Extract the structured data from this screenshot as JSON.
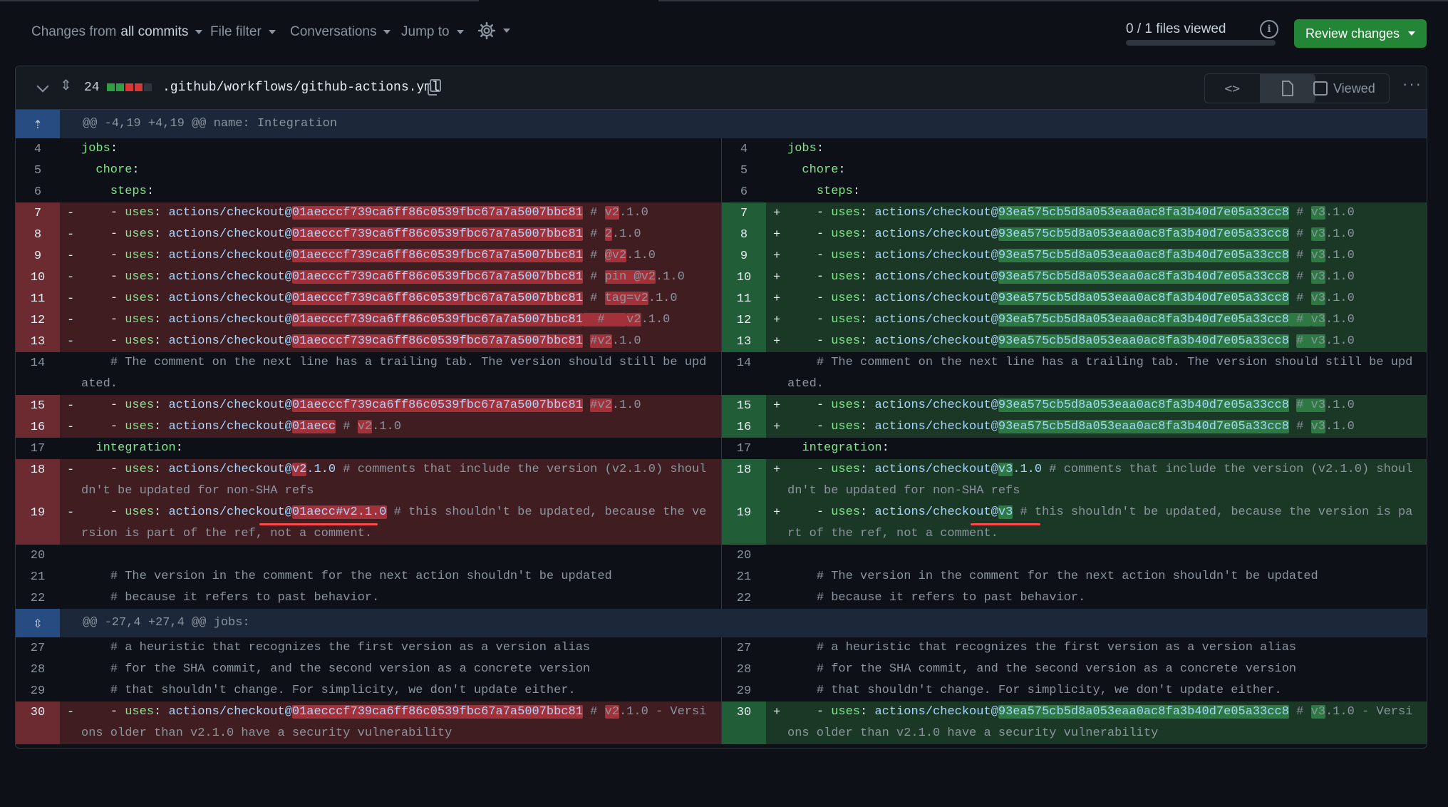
{
  "toolbar": {
    "changes_prefix": "Changes from",
    "changes_value": "all commits",
    "file_filter": "File filter",
    "conversations": "Conversations",
    "jump_to": "Jump to",
    "files_viewed": "0 / 1 files viewed",
    "progress": 0,
    "review_button": "Review changes"
  },
  "file": {
    "change_count": "24",
    "stat_blocks": [
      "#2ea043",
      "#2ea043",
      "#da3633",
      "#da3633",
      "#30363d"
    ],
    "path": ".github/workflows/github-actions.yml",
    "viewed_label": "Viewed"
  },
  "colors": {
    "accent_green": "#238636",
    "deletion": "#da3633",
    "addition": "#2ea043"
  },
  "hunks": [
    {
      "header": "@@ -4,19 +4,19 @@ name: Integration"
    },
    {
      "header": "@@ -27,4 +27,4 @@ jobs:"
    }
  ],
  "diff_rows": [
    {
      "type": "ctx",
      "ln": "4",
      "rn": "4",
      "left": [
        {
          "t": "jobs",
          "c": "k"
        },
        {
          "t": ":"
        }
      ],
      "right": [
        {
          "t": "jobs",
          "c": "k"
        },
        {
          "t": ":"
        }
      ]
    },
    {
      "type": "ctx",
      "ln": "5",
      "rn": "5",
      "left": [
        {
          "t": "  chore",
          "c": "k"
        },
        {
          "t": ":"
        }
      ],
      "right": [
        {
          "t": "  chore",
          "c": "k"
        },
        {
          "t": ":"
        }
      ]
    },
    {
      "type": "ctx",
      "ln": "6",
      "rn": "6",
      "left": [
        {
          "t": "    steps",
          "c": "k"
        },
        {
          "t": ":"
        }
      ],
      "right": [
        {
          "t": "    steps",
          "c": "k"
        },
        {
          "t": ":"
        }
      ]
    },
    {
      "type": "chg",
      "ln": "7",
      "rn": "7",
      "left": [
        {
          "t": "    - "
        },
        {
          "t": "uses",
          "c": "k"
        },
        {
          "t": ": "
        },
        {
          "t": "actions/checkout@",
          "c": "a"
        },
        {
          "t": "01aecccf739ca6ff86c0539fbc67a7a5007bbc81",
          "c": "a",
          "h": 1
        },
        {
          "t": " # ",
          "c": "c"
        },
        {
          "t": "v2",
          "c": "c",
          "h": 1
        },
        {
          "t": ".1.0",
          "c": "c"
        }
      ],
      "right": [
        {
          "t": "    - "
        },
        {
          "t": "uses",
          "c": "k"
        },
        {
          "t": ": "
        },
        {
          "t": "actions/checkout@",
          "c": "a"
        },
        {
          "t": "93ea575cb5d8a053eaa0ac8fa3b40d7e05a33cc8",
          "c": "a",
          "h": 1
        },
        {
          "t": " # ",
          "c": "c"
        },
        {
          "t": "v3",
          "c": "c",
          "h": 1
        },
        {
          "t": ".1.0",
          "c": "c"
        }
      ]
    },
    {
      "type": "chg",
      "ln": "8",
      "rn": "8",
      "left": [
        {
          "t": "    - "
        },
        {
          "t": "uses",
          "c": "k"
        },
        {
          "t": ": "
        },
        {
          "t": "actions/checkout@",
          "c": "a"
        },
        {
          "t": "01aecccf739ca6ff86c0539fbc67a7a5007bbc81",
          "c": "a",
          "h": 1
        },
        {
          "t": " # ",
          "c": "c"
        },
        {
          "t": "2",
          "c": "c",
          "h": 1
        },
        {
          "t": ".1.0",
          "c": "c"
        }
      ],
      "right": [
        {
          "t": "    - "
        },
        {
          "t": "uses",
          "c": "k"
        },
        {
          "t": ": "
        },
        {
          "t": "actions/checkout@",
          "c": "a"
        },
        {
          "t": "93ea575cb5d8a053eaa0ac8fa3b40d7e05a33cc8",
          "c": "a",
          "h": 1
        },
        {
          "t": " # ",
          "c": "c"
        },
        {
          "t": "v3",
          "c": "c",
          "h": 1
        },
        {
          "t": ".1.0",
          "c": "c"
        }
      ]
    },
    {
      "type": "chg",
      "ln": "9",
      "rn": "9",
      "left": [
        {
          "t": "    - "
        },
        {
          "t": "uses",
          "c": "k"
        },
        {
          "t": ": "
        },
        {
          "t": "actions/checkout@",
          "c": "a"
        },
        {
          "t": "01aecccf739ca6ff86c0539fbc67a7a5007bbc81",
          "c": "a",
          "h": 1
        },
        {
          "t": " # ",
          "c": "c"
        },
        {
          "t": "@v2",
          "c": "c",
          "h": 1
        },
        {
          "t": ".1.0",
          "c": "c"
        }
      ],
      "right": [
        {
          "t": "    - "
        },
        {
          "t": "uses",
          "c": "k"
        },
        {
          "t": ": "
        },
        {
          "t": "actions/checkout@",
          "c": "a"
        },
        {
          "t": "93ea575cb5d8a053eaa0ac8fa3b40d7e05a33cc8",
          "c": "a",
          "h": 1
        },
        {
          "t": " # ",
          "c": "c"
        },
        {
          "t": "v3",
          "c": "c",
          "h": 1
        },
        {
          "t": ".1.0",
          "c": "c"
        }
      ]
    },
    {
      "type": "chg",
      "ln": "10",
      "rn": "10",
      "left": [
        {
          "t": "    - "
        },
        {
          "t": "uses",
          "c": "k"
        },
        {
          "t": ": "
        },
        {
          "t": "actions/checkout@",
          "c": "a"
        },
        {
          "t": "01aecccf739ca6ff86c0539fbc67a7a5007bbc81",
          "c": "a",
          "h": 1
        },
        {
          "t": " # ",
          "c": "c"
        },
        {
          "t": "pin @v2",
          "c": "c",
          "h": 1
        },
        {
          "t": ".1.0",
          "c": "c"
        }
      ],
      "right": [
        {
          "t": "    - "
        },
        {
          "t": "uses",
          "c": "k"
        },
        {
          "t": ": "
        },
        {
          "t": "actions/checkout@",
          "c": "a"
        },
        {
          "t": "93ea575cb5d8a053eaa0ac8fa3b40d7e05a33cc8",
          "c": "a",
          "h": 1
        },
        {
          "t": " # ",
          "c": "c"
        },
        {
          "t": "v3",
          "c": "c",
          "h": 1
        },
        {
          "t": ".1.0",
          "c": "c"
        }
      ]
    },
    {
      "type": "chg",
      "ln": "11",
      "rn": "11",
      "left": [
        {
          "t": "    - "
        },
        {
          "t": "uses",
          "c": "k"
        },
        {
          "t": ": "
        },
        {
          "t": "actions/checkout@",
          "c": "a"
        },
        {
          "t": "01aecccf739ca6ff86c0539fbc67a7a5007bbc81",
          "c": "a",
          "h": 1
        },
        {
          "t": " # ",
          "c": "c"
        },
        {
          "t": "tag=v2",
          "c": "c",
          "h": 1
        },
        {
          "t": ".1.0",
          "c": "c"
        }
      ],
      "right": [
        {
          "t": "    - "
        },
        {
          "t": "uses",
          "c": "k"
        },
        {
          "t": ": "
        },
        {
          "t": "actions/checkout@",
          "c": "a"
        },
        {
          "t": "93ea575cb5d8a053eaa0ac8fa3b40d7e05a33cc8",
          "c": "a",
          "h": 1
        },
        {
          "t": " # ",
          "c": "c"
        },
        {
          "t": "v3",
          "c": "c",
          "h": 1
        },
        {
          "t": ".1.0",
          "c": "c"
        }
      ]
    },
    {
      "type": "chg",
      "ln": "12",
      "rn": "12",
      "left": [
        {
          "t": "    - "
        },
        {
          "t": "uses",
          "c": "k"
        },
        {
          "t": ": "
        },
        {
          "t": "actions/checkout@",
          "c": "a"
        },
        {
          "t": "01aecccf739ca6ff86c0539fbc67a7a5007bbc81",
          "c": "a",
          "h": 1
        },
        {
          "t": "  #   ",
          "c": "c",
          "h": 1
        },
        {
          "t": "v2",
          "c": "c",
          "h": 1
        },
        {
          "t": ".1.0",
          "c": "c"
        }
      ],
      "right": [
        {
          "t": "    - "
        },
        {
          "t": "uses",
          "c": "k"
        },
        {
          "t": ": "
        },
        {
          "t": "actions/checkout@",
          "c": "a"
        },
        {
          "t": "93ea575cb5d8a053eaa0ac8fa3b40d7e05a33cc8",
          "c": "a",
          "h": 1
        },
        {
          "t": " # ",
          "c": "c",
          "h": 1
        },
        {
          "t": "v3",
          "c": "c",
          "h": 1
        },
        {
          "t": ".1.0",
          "c": "c"
        }
      ]
    },
    {
      "type": "chg",
      "ln": "13",
      "rn": "13",
      "left": [
        {
          "t": "    - "
        },
        {
          "t": "uses",
          "c": "k"
        },
        {
          "t": ": "
        },
        {
          "t": "actions/checkout@",
          "c": "a"
        },
        {
          "t": "01aecccf739ca6ff86c0539fbc67a7a5007bbc81",
          "c": "a",
          "h": 1
        },
        {
          "t": " ",
          "c": "c"
        },
        {
          "t": "#v2",
          "c": "c",
          "h": 1
        },
        {
          "t": ".1.0",
          "c": "c"
        }
      ],
      "right": [
        {
          "t": "    - "
        },
        {
          "t": "uses",
          "c": "k"
        },
        {
          "t": ": "
        },
        {
          "t": "actions/checkout@",
          "c": "a"
        },
        {
          "t": "93ea575cb5d8a053eaa0ac8fa3b40d7e05a33cc8",
          "c": "a",
          "h": 1
        },
        {
          "t": " ",
          "c": "c"
        },
        {
          "t": "# v3",
          "c": "c",
          "h": 1
        },
        {
          "t": ".1.0",
          "c": "c"
        }
      ]
    },
    {
      "type": "ctx",
      "ln": "14",
      "rn": "14",
      "left": [
        {
          "t": "    # The comment on the next line has a trailing tab. The version should still be updated.",
          "c": "c"
        }
      ],
      "right": [
        {
          "t": "    # The comment on the next line has a trailing tab. The version should still be updated.",
          "c": "c"
        }
      ]
    },
    {
      "type": "chg",
      "ln": "15",
      "rn": "15",
      "left": [
        {
          "t": "    - "
        },
        {
          "t": "uses",
          "c": "k"
        },
        {
          "t": ": "
        },
        {
          "t": "actions/checkout@",
          "c": "a"
        },
        {
          "t": "01aecccf739ca6ff86c0539fbc67a7a5007bbc81",
          "c": "a",
          "h": 1
        },
        {
          "t": " ",
          "c": "c"
        },
        {
          "t": "#v2",
          "c": "c",
          "h": 1
        },
        {
          "t": ".1.0",
          "c": "c"
        }
      ],
      "right": [
        {
          "t": "    - "
        },
        {
          "t": "uses",
          "c": "k"
        },
        {
          "t": ": "
        },
        {
          "t": "actions/checkout@",
          "c": "a"
        },
        {
          "t": "93ea575cb5d8a053eaa0ac8fa3b40d7e05a33cc8",
          "c": "a",
          "h": 1
        },
        {
          "t": " ",
          "c": "c"
        },
        {
          "t": "# v3",
          "c": "c",
          "h": 1
        },
        {
          "t": ".1.0",
          "c": "c"
        }
      ]
    },
    {
      "type": "chg",
      "ln": "16",
      "rn": "16",
      "left": [
        {
          "t": "    - "
        },
        {
          "t": "uses",
          "c": "k"
        },
        {
          "t": ": "
        },
        {
          "t": "actions/checkout@",
          "c": "a"
        },
        {
          "t": "01aecc",
          "c": "a",
          "h": 1
        },
        {
          "t": " # ",
          "c": "c"
        },
        {
          "t": "v2",
          "c": "c",
          "h": 1
        },
        {
          "t": ".1.0",
          "c": "c"
        }
      ],
      "right": [
        {
          "t": "    - "
        },
        {
          "t": "uses",
          "c": "k"
        },
        {
          "t": ": "
        },
        {
          "t": "actions/checkout@",
          "c": "a"
        },
        {
          "t": "93ea575cb5d8a053eaa0ac8fa3b40d7e05a33cc8",
          "c": "a",
          "h": 1
        },
        {
          "t": " # ",
          "c": "c"
        },
        {
          "t": "v3",
          "c": "c",
          "h": 1
        },
        {
          "t": ".1.0",
          "c": "c"
        }
      ]
    },
    {
      "type": "ctx",
      "ln": "17",
      "rn": "17",
      "left": [
        {
          "t": "  integration",
          "c": "k"
        },
        {
          "t": ":"
        }
      ],
      "right": [
        {
          "t": "  integration",
          "c": "k"
        },
        {
          "t": ":"
        }
      ]
    },
    {
      "type": "chg",
      "ln": "18",
      "rn": "18",
      "left": [
        {
          "t": "    - "
        },
        {
          "t": "uses",
          "c": "k"
        },
        {
          "t": ": "
        },
        {
          "t": "actions/checkout@",
          "c": "a"
        },
        {
          "t": "v2",
          "c": "a",
          "h": 1
        },
        {
          "t": ".1.0",
          "c": "a"
        },
        {
          "t": " # comments that include the version (v2.1.0) shouldn't be updated for non-SHA refs",
          "c": "c"
        }
      ],
      "right": [
        {
          "t": "    - "
        },
        {
          "t": "uses",
          "c": "k"
        },
        {
          "t": ": "
        },
        {
          "t": "actions/checkout@",
          "c": "a"
        },
        {
          "t": "v3",
          "c": "a",
          "h": 1
        },
        {
          "t": ".1.0",
          "c": "a"
        },
        {
          "t": " # comments that include the version (v2.1.0) shouldn't be updated for non-SHA refs",
          "c": "c"
        }
      ]
    },
    {
      "type": "chg",
      "ln": "19",
      "rn": "19",
      "left": [
        {
          "t": "    - "
        },
        {
          "t": "uses",
          "c": "k"
        },
        {
          "t": ": "
        },
        {
          "t": "actions/checkout@",
          "c": "a"
        },
        {
          "t": "01aecc#v2.1.0",
          "c": "a",
          "h": 1
        },
        {
          "t": " # this shouldn't be updated, because the version is part of the ref, not a comment.",
          "c": "c"
        }
      ],
      "right": [
        {
          "t": "    - "
        },
        {
          "t": "uses",
          "c": "k"
        },
        {
          "t": ": "
        },
        {
          "t": "actions/checkout@",
          "c": "a"
        },
        {
          "t": "v3",
          "c": "a",
          "h": 1
        },
        {
          "t": " # this shouldn't be updated, because the version is part of the ref, not a comment.",
          "c": "c"
        }
      ]
    },
    {
      "type": "ctx",
      "ln": "20",
      "rn": "20",
      "left": [
        {
          "t": ""
        }
      ],
      "right": [
        {
          "t": ""
        }
      ]
    },
    {
      "type": "ctx",
      "ln": "21",
      "rn": "21",
      "left": [
        {
          "t": "    # The version in the comment for the next action shouldn't be updated",
          "c": "c"
        }
      ],
      "right": [
        {
          "t": "    # The version in the comment for the next action shouldn't be updated",
          "c": "c"
        }
      ]
    },
    {
      "type": "ctx",
      "ln": "22",
      "rn": "22",
      "left": [
        {
          "t": "    # because it refers to past behavior.",
          "c": "c"
        }
      ],
      "right": [
        {
          "t": "    # because it refers to past behavior.",
          "c": "c"
        }
      ]
    },
    {
      "type": "hunk",
      "hi": 1
    },
    {
      "type": "ctx",
      "ln": "27",
      "rn": "27",
      "left": [
        {
          "t": "    # a heuristic that recognizes the first version as a version alias",
          "c": "c"
        }
      ],
      "right": [
        {
          "t": "    # a heuristic that recognizes the first version as a version alias",
          "c": "c"
        }
      ]
    },
    {
      "type": "ctx",
      "ln": "28",
      "rn": "28",
      "left": [
        {
          "t": "    # for the SHA commit, and the second version as a concrete version",
          "c": "c"
        }
      ],
      "right": [
        {
          "t": "    # for the SHA commit, and the second version as a concrete version",
          "c": "c"
        }
      ]
    },
    {
      "type": "ctx",
      "ln": "29",
      "rn": "29",
      "left": [
        {
          "t": "    # that shouldn't change. For simplicity, we don't update either.",
          "c": "c"
        }
      ],
      "right": [
        {
          "t": "    # that shouldn't change. For simplicity, we don't update either.",
          "c": "c"
        }
      ]
    },
    {
      "type": "chg",
      "ln": "30",
      "rn": "30",
      "left": [
        {
          "t": "    - "
        },
        {
          "t": "uses",
          "c": "k"
        },
        {
          "t": ": "
        },
        {
          "t": "actions/checkout@",
          "c": "a"
        },
        {
          "t": "01aecccf739ca6ff86c0539fbc67a7a5007bbc81",
          "c": "a",
          "h": 1
        },
        {
          "t": " # ",
          "c": "c"
        },
        {
          "t": "v2",
          "c": "c",
          "h": 1
        },
        {
          "t": ".1.0 - Versions older than v2.1.0 have a security vulnerability",
          "c": "c"
        }
      ],
      "right": [
        {
          "t": "    - "
        },
        {
          "t": "uses",
          "c": "k"
        },
        {
          "t": ": "
        },
        {
          "t": "actions/checkout@",
          "c": "a"
        },
        {
          "t": "93ea575cb5d8a053eaa0ac8fa3b40d7e05a33cc8",
          "c": "a",
          "h": 1
        },
        {
          "t": " # ",
          "c": "c"
        },
        {
          "t": "v3",
          "c": "c",
          "h": 1
        },
        {
          "t": ".1.0 - Versions older than v2.1.0 have a security vulnerability",
          "c": "c"
        }
      ]
    }
  ],
  "markers": {
    "del": "-",
    "add": "+"
  }
}
